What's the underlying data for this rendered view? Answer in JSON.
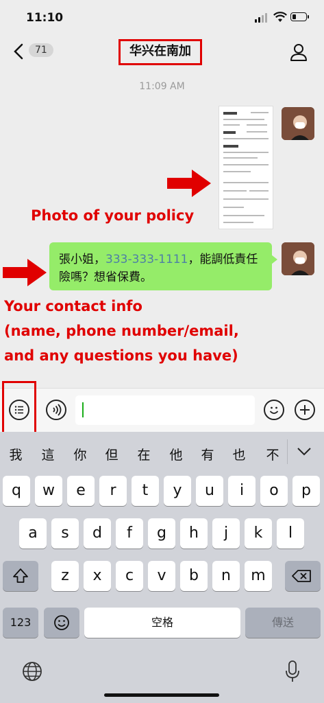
{
  "status_bar": {
    "time": "11:10"
  },
  "nav": {
    "back_count": "71",
    "title": "华兴在南加"
  },
  "chat": {
    "timestamp": "11:09 AM",
    "message_text_part1": "張小姐，",
    "message_phone": "333-333-1111",
    "message_text_part2": "，能調低責任險嗎？想省保費。"
  },
  "annotations": {
    "photo_caption": "Photo of your policy",
    "contact_line1": "Your contact info",
    "contact_line2": "(name, phone number/email,",
    "contact_line3": "and any questions you have)",
    "highlight_color": "#e00000"
  },
  "keyboard": {
    "candidates": [
      "我",
      "這",
      "你",
      "但",
      "在",
      "他",
      "有",
      "也",
      "不"
    ],
    "row1": [
      "q",
      "w",
      "e",
      "r",
      "t",
      "y",
      "u",
      "i",
      "o",
      "p"
    ],
    "row2": [
      "a",
      "s",
      "d",
      "f",
      "g",
      "h",
      "j",
      "k",
      "l"
    ],
    "row3": [
      "z",
      "x",
      "c",
      "v",
      "b",
      "n",
      "m"
    ],
    "numbers_label": "123",
    "space_label": "空格",
    "send_label": "傳送"
  },
  "colors": {
    "bubble": "#95ec69",
    "keyboard_bg": "#d1d3d9",
    "phone_link": "#4d7fa6"
  }
}
